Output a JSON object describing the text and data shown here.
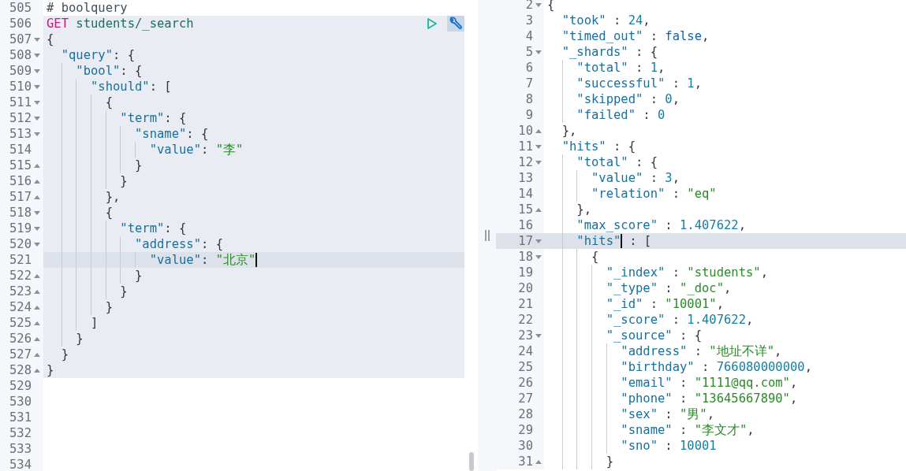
{
  "request_editor": {
    "lines": [
      {
        "number": "505",
        "kind": "plain",
        "in_request": false,
        "active": false,
        "tokens": [
          {
            "kind": "comment",
            "text": "# boolquery"
          }
        ]
      },
      {
        "number": "506",
        "kind": "plain",
        "in_request": true,
        "active": false,
        "tokens": [
          {
            "kind": "method",
            "text": "GET"
          },
          {
            "kind": "url",
            "text": " students/_search"
          }
        ]
      },
      {
        "number": "507",
        "kind": "opener",
        "in_request": true,
        "active": false,
        "tokens": [
          {
            "kind": "punct",
            "text": "{"
          }
        ]
      },
      {
        "number": "508",
        "kind": "opener",
        "in_request": true,
        "active": false,
        "tokens": [
          {
            "kind": "key",
            "text": "  \"query\""
          },
          {
            "kind": "punct",
            "text": ": {"
          }
        ]
      },
      {
        "number": "509",
        "kind": "opener",
        "in_request": true,
        "active": false,
        "tokens": [
          {
            "kind": "key",
            "text": "    \"bool\""
          },
          {
            "kind": "punct",
            "text": ": {"
          }
        ]
      },
      {
        "number": "510",
        "kind": "opener",
        "in_request": true,
        "active": false,
        "tokens": [
          {
            "kind": "key",
            "text": "      \"should\""
          },
          {
            "kind": "punct",
            "text": ": ["
          }
        ]
      },
      {
        "number": "511",
        "kind": "opener",
        "in_request": true,
        "active": false,
        "tokens": [
          {
            "kind": "punct",
            "text": "        {"
          }
        ]
      },
      {
        "number": "512",
        "kind": "opener",
        "in_request": true,
        "active": false,
        "tokens": [
          {
            "kind": "key",
            "text": "          \"term\""
          },
          {
            "kind": "punct",
            "text": ": {"
          }
        ]
      },
      {
        "number": "513",
        "kind": "opener",
        "in_request": true,
        "active": false,
        "tokens": [
          {
            "kind": "key",
            "text": "            \"sname\""
          },
          {
            "kind": "punct",
            "text": ": {"
          }
        ]
      },
      {
        "number": "514",
        "kind": "plain",
        "in_request": true,
        "active": false,
        "tokens": [
          {
            "kind": "key",
            "text": "              \"value\""
          },
          {
            "kind": "punct",
            "text": ": "
          },
          {
            "kind": "string",
            "text": "\"李\""
          }
        ]
      },
      {
        "number": "515",
        "kind": "closer",
        "in_request": true,
        "active": false,
        "tokens": [
          {
            "kind": "punct",
            "text": "            }"
          }
        ]
      },
      {
        "number": "516",
        "kind": "closer",
        "in_request": true,
        "active": false,
        "tokens": [
          {
            "kind": "punct",
            "text": "          }"
          }
        ]
      },
      {
        "number": "517",
        "kind": "closer",
        "in_request": true,
        "active": false,
        "tokens": [
          {
            "kind": "punct",
            "text": "        },"
          }
        ]
      },
      {
        "number": "518",
        "kind": "opener",
        "in_request": true,
        "active": false,
        "tokens": [
          {
            "kind": "punct",
            "text": "        {"
          }
        ]
      },
      {
        "number": "519",
        "kind": "opener",
        "in_request": true,
        "active": false,
        "tokens": [
          {
            "kind": "key",
            "text": "          \"term\""
          },
          {
            "kind": "punct",
            "text": ": {"
          }
        ]
      },
      {
        "number": "520",
        "kind": "opener",
        "in_request": true,
        "active": false,
        "tokens": [
          {
            "kind": "key",
            "text": "            \"address\""
          },
          {
            "kind": "punct",
            "text": ": {"
          }
        ]
      },
      {
        "number": "521",
        "kind": "plain",
        "in_request": true,
        "active": true,
        "tokens": [
          {
            "kind": "key",
            "text": "              \"value\""
          },
          {
            "kind": "punct",
            "text": ": "
          },
          {
            "kind": "string",
            "text": "\"北京\"",
            "cursor": true
          }
        ]
      },
      {
        "number": "522",
        "kind": "closer",
        "in_request": true,
        "active": false,
        "tokens": [
          {
            "kind": "punct",
            "text": "            }"
          }
        ]
      },
      {
        "number": "523",
        "kind": "closer",
        "in_request": true,
        "active": false,
        "tokens": [
          {
            "kind": "punct",
            "text": "          }"
          }
        ]
      },
      {
        "number": "524",
        "kind": "closer",
        "in_request": true,
        "active": false,
        "tokens": [
          {
            "kind": "punct",
            "text": "        }"
          }
        ]
      },
      {
        "number": "525",
        "kind": "closer",
        "in_request": true,
        "active": false,
        "tokens": [
          {
            "kind": "punct",
            "text": "      ]"
          }
        ]
      },
      {
        "number": "526",
        "kind": "closer",
        "in_request": true,
        "active": false,
        "tokens": [
          {
            "kind": "punct",
            "text": "    }"
          }
        ]
      },
      {
        "number": "527",
        "kind": "closer",
        "in_request": true,
        "active": false,
        "tokens": [
          {
            "kind": "punct",
            "text": "  }"
          }
        ]
      },
      {
        "number": "528",
        "kind": "closer",
        "in_request": true,
        "active": false,
        "tokens": [
          {
            "kind": "punct",
            "text": "}"
          }
        ]
      },
      {
        "number": "529",
        "kind": "plain",
        "in_request": false,
        "active": false
      },
      {
        "number": "530",
        "kind": "plain",
        "in_request": false,
        "active": false
      },
      {
        "number": "531",
        "kind": "plain",
        "in_request": false,
        "active": false
      },
      {
        "number": "532",
        "kind": "plain",
        "in_request": false,
        "active": false
      },
      {
        "number": "533",
        "kind": "plain",
        "in_request": false,
        "active": false
      },
      {
        "number": "534",
        "kind": "plain",
        "in_request": false,
        "active": false
      }
    ]
  },
  "response_viewer": {
    "lines": [
      {
        "number": "2",
        "kind": "opener",
        "active": false,
        "tokens": [
          {
            "kind": "punct",
            "text": "{"
          }
        ]
      },
      {
        "number": "3",
        "kind": "plain",
        "active": false,
        "tokens": [
          {
            "kind": "key",
            "text": "  \"took\""
          },
          {
            "kind": "punct",
            "text": " : "
          },
          {
            "kind": "number",
            "text": "24"
          },
          {
            "kind": "punct",
            "text": ","
          }
        ]
      },
      {
        "number": "4",
        "kind": "plain",
        "active": false,
        "tokens": [
          {
            "kind": "key",
            "text": "  \"timed_out\""
          },
          {
            "kind": "punct",
            "text": " : "
          },
          {
            "kind": "bool",
            "text": "false"
          },
          {
            "kind": "punct",
            "text": ","
          }
        ]
      },
      {
        "number": "5",
        "kind": "opener",
        "active": false,
        "tokens": [
          {
            "kind": "key",
            "text": "  \"_shards\""
          },
          {
            "kind": "punct",
            "text": " : {"
          }
        ]
      },
      {
        "number": "6",
        "kind": "plain",
        "active": false,
        "tokens": [
          {
            "kind": "key",
            "text": "    \"total\""
          },
          {
            "kind": "punct",
            "text": " : "
          },
          {
            "kind": "number",
            "text": "1"
          },
          {
            "kind": "punct",
            "text": ","
          }
        ]
      },
      {
        "number": "7",
        "kind": "plain",
        "active": false,
        "tokens": [
          {
            "kind": "key",
            "text": "    \"successful\""
          },
          {
            "kind": "punct",
            "text": " : "
          },
          {
            "kind": "number",
            "text": "1"
          },
          {
            "kind": "punct",
            "text": ","
          }
        ]
      },
      {
        "number": "8",
        "kind": "plain",
        "active": false,
        "tokens": [
          {
            "kind": "key",
            "text": "    \"skipped\""
          },
          {
            "kind": "punct",
            "text": " : "
          },
          {
            "kind": "number",
            "text": "0"
          },
          {
            "kind": "punct",
            "text": ","
          }
        ]
      },
      {
        "number": "9",
        "kind": "plain",
        "active": false,
        "tokens": [
          {
            "kind": "key",
            "text": "    \"failed\""
          },
          {
            "kind": "punct",
            "text": " : "
          },
          {
            "kind": "number",
            "text": "0"
          }
        ]
      },
      {
        "number": "10",
        "kind": "closer",
        "active": false,
        "tokens": [
          {
            "kind": "punct",
            "text": "  },"
          }
        ]
      },
      {
        "number": "11",
        "kind": "opener",
        "active": false,
        "tokens": [
          {
            "kind": "key",
            "text": "  \"hits\""
          },
          {
            "kind": "punct",
            "text": " : {"
          }
        ]
      },
      {
        "number": "12",
        "kind": "opener",
        "active": false,
        "tokens": [
          {
            "kind": "key",
            "text": "    \"total\""
          },
          {
            "kind": "punct",
            "text": " : {"
          }
        ]
      },
      {
        "number": "13",
        "kind": "plain",
        "active": false,
        "tokens": [
          {
            "kind": "key",
            "text": "      \"value\""
          },
          {
            "kind": "punct",
            "text": " : "
          },
          {
            "kind": "number",
            "text": "3"
          },
          {
            "kind": "punct",
            "text": ","
          }
        ]
      },
      {
        "number": "14",
        "kind": "plain",
        "active": false,
        "tokens": [
          {
            "kind": "key",
            "text": "      \"relation\""
          },
          {
            "kind": "punct",
            "text": " : "
          },
          {
            "kind": "string",
            "text": "\"eq\""
          }
        ]
      },
      {
        "number": "15",
        "kind": "closer",
        "active": false,
        "tokens": [
          {
            "kind": "punct",
            "text": "    },"
          }
        ]
      },
      {
        "number": "16",
        "kind": "plain",
        "active": false,
        "tokens": [
          {
            "kind": "key",
            "text": "    \"max_score\""
          },
          {
            "kind": "punct",
            "text": " : "
          },
          {
            "kind": "number",
            "text": "1.407622"
          },
          {
            "kind": "punct",
            "text": ","
          }
        ]
      },
      {
        "number": "17",
        "kind": "opener",
        "active": true,
        "tokens": [
          {
            "kind": "key",
            "text": "    \"hits\"",
            "cursor": true
          },
          {
            "kind": "punct",
            "text": " : ["
          }
        ]
      },
      {
        "number": "18",
        "kind": "opener",
        "active": false,
        "tokens": [
          {
            "kind": "punct",
            "text": "      {"
          }
        ]
      },
      {
        "number": "19",
        "kind": "plain",
        "active": false,
        "tokens": [
          {
            "kind": "key",
            "text": "        \"_index\""
          },
          {
            "kind": "punct",
            "text": " : "
          },
          {
            "kind": "string",
            "text": "\"students\""
          },
          {
            "kind": "punct",
            "text": ","
          }
        ]
      },
      {
        "number": "20",
        "kind": "plain",
        "active": false,
        "tokens": [
          {
            "kind": "key",
            "text": "        \"_type\""
          },
          {
            "kind": "punct",
            "text": " : "
          },
          {
            "kind": "string",
            "text": "\"_doc\""
          },
          {
            "kind": "punct",
            "text": ","
          }
        ]
      },
      {
        "number": "21",
        "kind": "plain",
        "active": false,
        "tokens": [
          {
            "kind": "key",
            "text": "        \"_id\""
          },
          {
            "kind": "punct",
            "text": " : "
          },
          {
            "kind": "string",
            "text": "\"10001\""
          },
          {
            "kind": "punct",
            "text": ","
          }
        ]
      },
      {
        "number": "22",
        "kind": "plain",
        "active": false,
        "tokens": [
          {
            "kind": "key",
            "text": "        \"_score\""
          },
          {
            "kind": "punct",
            "text": " : "
          },
          {
            "kind": "number",
            "text": "1.407622"
          },
          {
            "kind": "punct",
            "text": ","
          }
        ]
      },
      {
        "number": "23",
        "kind": "opener",
        "active": false,
        "tokens": [
          {
            "kind": "key",
            "text": "        \"_source\""
          },
          {
            "kind": "punct",
            "text": " : {"
          }
        ]
      },
      {
        "number": "24",
        "kind": "plain",
        "active": false,
        "tokens": [
          {
            "kind": "key",
            "text": "          \"address\""
          },
          {
            "kind": "punct",
            "text": " : "
          },
          {
            "kind": "string",
            "text": "\"地址不详\""
          },
          {
            "kind": "punct",
            "text": ","
          }
        ]
      },
      {
        "number": "25",
        "kind": "plain",
        "active": false,
        "tokens": [
          {
            "kind": "key",
            "text": "          \"birthday\""
          },
          {
            "kind": "punct",
            "text": " : "
          },
          {
            "kind": "number",
            "text": "766080000000"
          },
          {
            "kind": "punct",
            "text": ","
          }
        ]
      },
      {
        "number": "26",
        "kind": "plain",
        "active": false,
        "tokens": [
          {
            "kind": "key",
            "text": "          \"email\""
          },
          {
            "kind": "punct",
            "text": " : "
          },
          {
            "kind": "string",
            "text": "\"1111@qq.com\""
          },
          {
            "kind": "punct",
            "text": ","
          }
        ]
      },
      {
        "number": "27",
        "kind": "plain",
        "active": false,
        "tokens": [
          {
            "kind": "key",
            "text": "          \"phone\""
          },
          {
            "kind": "punct",
            "text": " : "
          },
          {
            "kind": "string",
            "text": "\"13645667890\""
          },
          {
            "kind": "punct",
            "text": ","
          }
        ]
      },
      {
        "number": "28",
        "kind": "plain",
        "active": false,
        "tokens": [
          {
            "kind": "key",
            "text": "          \"sex\""
          },
          {
            "kind": "punct",
            "text": " : "
          },
          {
            "kind": "string",
            "text": "\"男\""
          },
          {
            "kind": "punct",
            "text": ","
          }
        ]
      },
      {
        "number": "29",
        "kind": "plain",
        "active": false,
        "tokens": [
          {
            "kind": "key",
            "text": "          \"sname\""
          },
          {
            "kind": "punct",
            "text": " : "
          },
          {
            "kind": "string",
            "text": "\"李文才\""
          },
          {
            "kind": "punct",
            "text": ","
          }
        ]
      },
      {
        "number": "30",
        "kind": "plain",
        "active": false,
        "tokens": [
          {
            "kind": "key",
            "text": "          \"sno\""
          },
          {
            "kind": "punct",
            "text": " : "
          },
          {
            "kind": "number",
            "text": "10001"
          }
        ]
      },
      {
        "number": "31",
        "kind": "closer",
        "active": false,
        "tokens": [
          {
            "kind": "punct",
            "text": "        }"
          }
        ]
      }
    ]
  }
}
